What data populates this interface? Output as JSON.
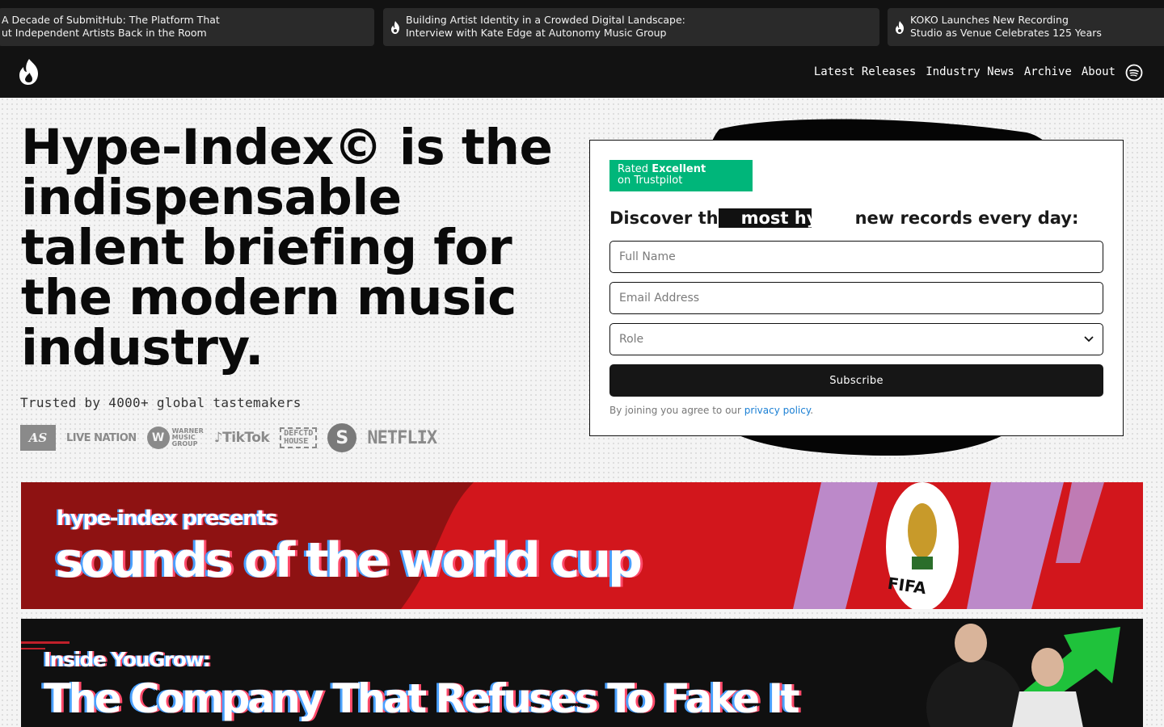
{
  "ticker": {
    "items": [
      {
        "line1": "A Decade of SubmitHub: The Platform That",
        "line2": "ut Independent Artists Back in the Room"
      },
      {
        "line1": "Building Artist Identity in a Crowded Digital Landscape:",
        "line2": "Interview with Kate Edge at Autonomy Music Group"
      },
      {
        "line1": "KOKO Launches New Recording",
        "line2": "Studio as Venue Celebrates 125 Years"
      }
    ]
  },
  "nav": {
    "logo_icon": "flame-logo-icon",
    "links": [
      "Latest Releases",
      "Industry News",
      "Archive",
      "About"
    ],
    "spotify_icon": "spotify-icon"
  },
  "hero": {
    "headline": "Hype-Index© is the indispensable talent briefing for the modern music industry.",
    "trusted": "Trusted by 4000+ global tastemakers",
    "logos": {
      "atlantic": "AS",
      "live_nation": "LIVE NATION",
      "wmg_mark": "W",
      "wmg_text": [
        "WARNER",
        "MUSIC",
        "GROUP"
      ],
      "tiktok": "TikTok",
      "defected": [
        "DEFCTD",
        "HOUSE"
      ],
      "spinnin": "S",
      "netflix": "NETFLIX"
    }
  },
  "signup": {
    "trustpilot_prefix": "Rated ",
    "trustpilot_strong": "Excellent",
    "trustpilot_suffix": "on Trustpilot",
    "discover_pre": "Discover th",
    "discover_highlight": "most hy",
    "discover_post": "new records every day:",
    "full_name_placeholder": "Full Name",
    "email_placeholder": "Email Address",
    "role_placeholder": "Role",
    "subscribe_label": "Subscribe",
    "terms_prefix": "By joining you agree to our ",
    "terms_link": "privacy policy",
    "terms_suffix": "."
  },
  "banners": [
    {
      "kicker": "hype-index presents",
      "title": "sounds of the world cup",
      "badge": "FIFA"
    },
    {
      "kicker": "Inside YouGrow:",
      "title": "The Company That Refuses To Fake It"
    }
  ],
  "colors": {
    "trustpilot": "#00b67a",
    "dark": "#121212",
    "link": "#1a7fd4",
    "banner_red": "#8e1212"
  }
}
